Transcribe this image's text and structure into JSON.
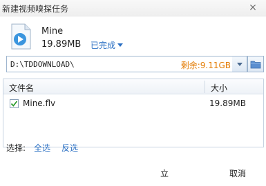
{
  "window": {
    "title": "新建视频嗅探任务"
  },
  "file": {
    "name": "Mine",
    "size": "19.89MB",
    "status": "已完成"
  },
  "path": {
    "value": "D:\\TDDOWNLOAD\\",
    "free_space": "剩余:9.11GB"
  },
  "list": {
    "headers": {
      "name": "文件名",
      "size": "大小"
    },
    "rows": [
      {
        "name": "Mine.flv",
        "size": "19.89MB",
        "checked": true
      }
    ]
  },
  "selection": {
    "label": "选择:",
    "all": "全选",
    "invert": "反选"
  },
  "footer": {
    "prefix": "立",
    "cancel": "取消"
  },
  "colors": {
    "link": "#2a6fc3",
    "free_space": "#e37a00"
  }
}
